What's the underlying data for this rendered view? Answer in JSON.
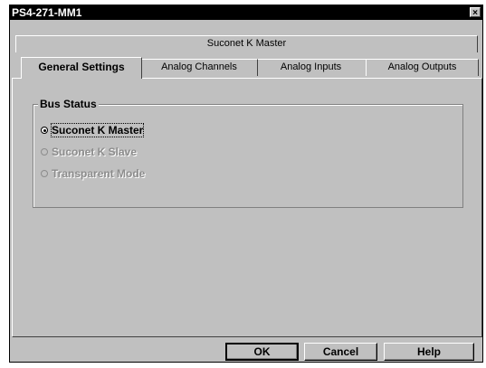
{
  "window": {
    "title": "PS4-271-MM1",
    "close_glyph": "×"
  },
  "tabs": {
    "row1": [
      "Suconet K Master"
    ],
    "row2": [
      "General Settings",
      "Analog Channels",
      "Analog Inputs",
      "Analog Outputs"
    ],
    "active": "General Settings"
  },
  "groupbox": {
    "label": "Bus Status",
    "options": [
      {
        "label": "Suconet K Master",
        "selected": true,
        "enabled": true
      },
      {
        "label": "Suconet K Slave",
        "selected": false,
        "enabled": false
      },
      {
        "label": "Transparent Mode",
        "selected": false,
        "enabled": false
      }
    ]
  },
  "buttons": {
    "ok": "OK",
    "cancel": "Cancel",
    "help": "Help"
  }
}
